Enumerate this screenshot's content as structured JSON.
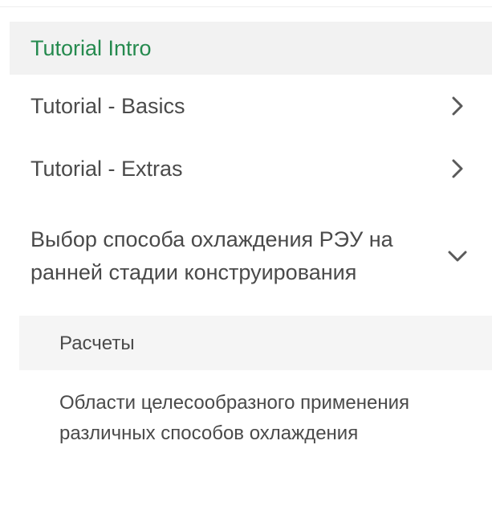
{
  "nav": {
    "items": [
      {
        "label": "Tutorial Intro",
        "state": "active"
      },
      {
        "label": "Tutorial - Basics",
        "icon": "chevron-right-icon"
      },
      {
        "label": "Tutorial - Extras",
        "icon": "chevron-right-icon"
      },
      {
        "label": "Выбор способа охлаждения РЭУ на ранней стадии конструирования",
        "icon": "chevron-down-icon",
        "expanded": true,
        "children": [
          {
            "label": "Расчеты"
          },
          {
            "label": "Области целесообразного применения различных способов охлаждения"
          }
        ]
      }
    ]
  },
  "colors": {
    "active_text": "#258a4e",
    "active_bg": "#f2f2f2",
    "text": "#4a4a4a",
    "chevron": "#5a5a5a"
  }
}
